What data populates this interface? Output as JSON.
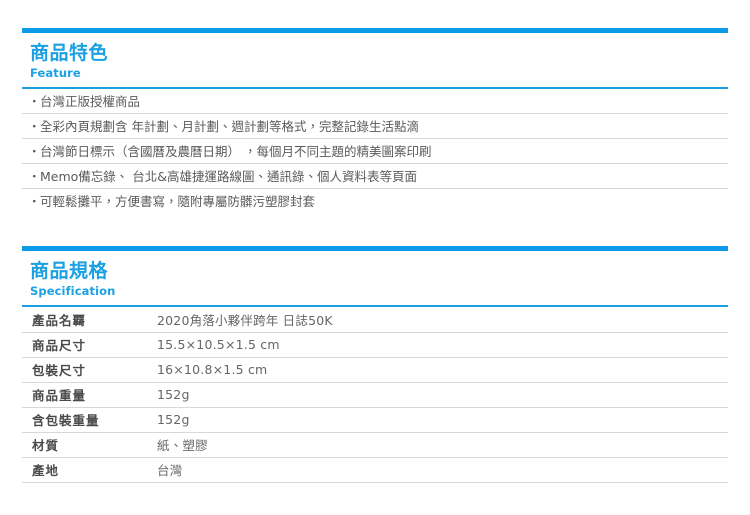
{
  "theme": {
    "accent_blue": "#0d9ae8",
    "rule_blue": "#1ba1e2",
    "divider_gray": "#d8d8d8",
    "body_text": "#5a5a5a"
  },
  "feature_section": {
    "title_cn": "商品特色",
    "title_en": "Feature",
    "bullet": "・",
    "items": [
      {
        "text": "台灣正版授權商品"
      },
      {
        "text": "全彩內頁規劃含 年計劃、月計劃、週計劃等格式，完整記錄生活點滴"
      },
      {
        "text": "台灣節日標示（含國曆及農曆日期） ，每個月不同主題的精美圖案印刷"
      },
      {
        "text": "Memo備忘錄、 台北&高雄捷運路線圖、通訊錄、個人資料表等頁面"
      },
      {
        "text": "可輕鬆攤平，方便書寫，隨附專屬防髒污塑膠封套"
      }
    ]
  },
  "spec_section": {
    "title_cn": "商品規格",
    "title_en": "Specification",
    "rows": [
      {
        "label": "產品名覉",
        "value": "2020角落小夥伴跨年 日誌50K"
      },
      {
        "label": "商品尺寸",
        "value": "15.5×10.5×1.5 cm"
      },
      {
        "label": "包裝尺寸",
        "value": "16×10.8×1.5 cm"
      },
      {
        "label": "商品重量",
        "value": "152g"
      },
      {
        "label": "含包裝重量",
        "value": "152g"
      },
      {
        "label": "材質",
        "value": "紙、塑膠"
      },
      {
        "label": "產地",
        "value": "台灣"
      }
    ]
  }
}
